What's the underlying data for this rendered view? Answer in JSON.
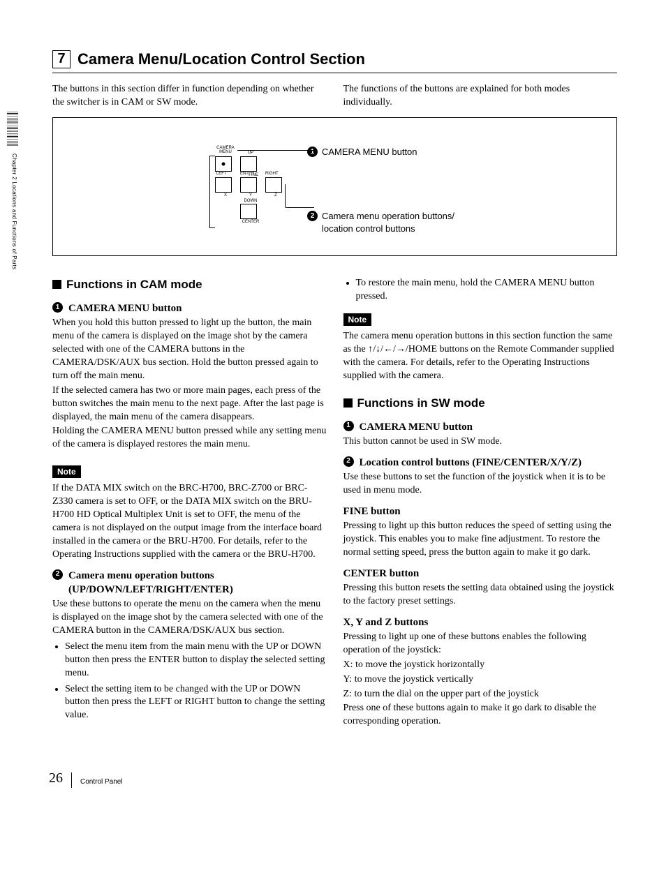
{
  "header": {
    "num": "7",
    "title": "Camera Menu/Location Control Section"
  },
  "intro": {
    "left": "The buttons in this section differ in function depending on whether the switcher is in CAM or SW mode.",
    "right": "The functions of the buttons are explained for both modes individually."
  },
  "diagram": {
    "labels": {
      "camera_menu": "CAMERA\nMENU",
      "up": "UP",
      "fine": "FINE",
      "left": "LEFT",
      "enter": "ENTER",
      "right": "RIGHT",
      "x": "X",
      "y": "Y",
      "z": "Z",
      "down": "DOWN",
      "center": "CENTER"
    },
    "callouts": {
      "c1": "CAMERA MENU button",
      "c2a": "Camera menu operation buttons/",
      "c2b": "location control buttons"
    }
  },
  "cam": {
    "heading": "Functions in CAM mode",
    "i1_title": "CAMERA MENU button",
    "i1_p1": "When you hold this button pressed to light up the button, the main menu of the camera is displayed on the image shot by the camera selected with one of the CAMERA buttons in the CAMERA/DSK/AUX bus section. Hold the button pressed again to turn off the main menu.",
    "i1_p2": "If the selected camera has two or more main pages, each press of the button switches the main menu to the next page. After the last page is displayed, the main menu of the camera disappears.",
    "i1_p3": "Holding the CAMERA MENU button pressed while any setting menu of the camera is displayed restores the main menu.",
    "note1": "If the DATA MIX switch on the BRC-H700, BRC-Z700 or BRC-Z330 camera is set to OFF, or the DATA MIX switch on the BRU-H700 HD Optical Multiplex Unit is set to OFF, the menu of the camera is not displayed on the output image from the interface board installed in the camera or the BRU-H700. For details, refer to the Operating Instructions supplied with the camera or the BRU-H700.",
    "i2_title": "Camera menu operation buttons (UP/DOWN/LEFT/RIGHT/ENTER)",
    "i2_p1": "Use these buttons to operate the menu on the camera when the menu is displayed on the image shot by the camera selected with one of the CAMERA button in the CAMERA/DSK/AUX bus section.",
    "i2_b1": "Select the menu item from the main menu with the UP or DOWN button then press the ENTER button to display the selected setting menu.",
    "i2_b2": "Select the setting item to be changed with the UP or DOWN button then press the LEFT or RIGHT button to change the setting value.",
    "i2_b3": "To restore the main menu, hold the CAMERA MENU button pressed.",
    "note2": "The camera menu operation buttons in this section function the same as the ↑/↓/←/→/HOME buttons on the Remote Commander supplied with the camera. For details, refer to the Operating Instructions supplied with the camera."
  },
  "sw": {
    "heading": "Functions in SW mode",
    "i1_title": "CAMERA MENU button",
    "i1_p1": "This button cannot be used in SW mode.",
    "i2_title": "Location control buttons (FINE/CENTER/X/Y/Z)",
    "i2_p1": "Use these buttons to set the function of the joystick when it is to be used in menu mode.",
    "fine_h": "FINE button",
    "fine_p": "Pressing to light up this button reduces the speed of setting using the joystick. This enables you to make fine adjustment. To restore the normal setting speed, press the button again to make it go dark.",
    "center_h": "CENTER button",
    "center_p": "Pressing this button resets the setting data obtained using the joystick to the factory preset settings.",
    "xyz_h": "X, Y and Z buttons",
    "xyz_p1": "Pressing to light up one of these buttons enables the following operation of the joystick:",
    "xyz_x": "X: to move the joystick horizontally",
    "xyz_y": "Y: to move the joystick vertically",
    "xyz_z": "Z: to turn the dial on the upper part of the joystick",
    "xyz_p2": "Press one of these buttons again to make it go dark to disable the corresponding operation."
  },
  "note_label": "Note",
  "side_tab": "Chapter 2  Locations and Functions of Parts",
  "footer": {
    "page": "26",
    "section": "Control Panel"
  }
}
